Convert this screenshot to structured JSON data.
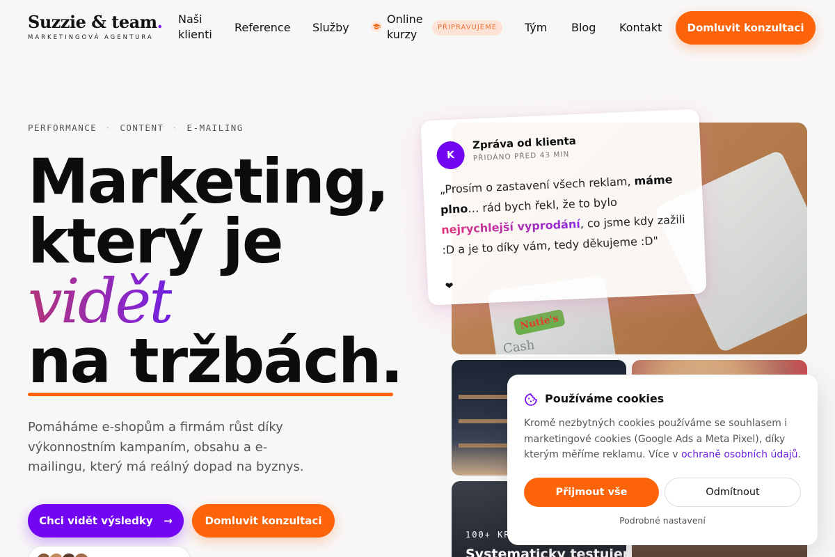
{
  "brand": {
    "name": "Suzzie & team",
    "dot": ".",
    "tagline": "MARKETINGOVÁ AGENTURA",
    "accent_color": "#7306f2",
    "cta_color": "#fd6409"
  },
  "nav": {
    "items": [
      {
        "label_line1": "Naši",
        "label_line2": "klienti"
      },
      {
        "label": "Reference"
      },
      {
        "label": "Služby"
      },
      {
        "label_line1": "Online",
        "label_line2": "kurzy",
        "icon": "graduation-cap-icon",
        "badge": "PŘIPRAVUJEME"
      },
      {
        "label": "Tým"
      },
      {
        "label": "Blog"
      },
      {
        "label": "Kontakt"
      }
    ],
    "cta": "Domluvit konzultaci"
  },
  "hero": {
    "eyebrow": [
      "PERFORMANCE",
      "CONTENT",
      "E-MAILING"
    ],
    "eyebrow_separator": "·",
    "title_line1": "Marketing,",
    "title_line2": "který je",
    "title_line3": "vidět",
    "title_line4": "na tržbách.",
    "description": "Pomáháme e-shopům a firmám růst díky výkonnostním kampaním, obsahu a e-mailingu, který má reálný dopad na byznys.",
    "primary_cta": "Chci vidět výsledky",
    "primary_cta_arrow": "→",
    "secondary_cta": "Domluvit konzultaci"
  },
  "client_message": {
    "avatar_letter": "K",
    "from": "Zpráva od klienta",
    "time": "PŘIDÁNO PŘED 43 MIN",
    "text_part1": "„Prosím o zastavení všech reklam, ",
    "text_bold": "máme plno",
    "text_part2": "… rád bych řekl, že to bylo ",
    "text_highlight": "nejrychlejší vyprodání",
    "text_part3": ", co jsme kdy zažili :D a je to díky vám, tedy děkujeme :D\"",
    "reaction": "❤"
  },
  "gallery": {
    "main_label": "Nutie's",
    "main_sub": "Cash",
    "tile_kicker": "100+ KR",
    "tile_title": "Systematicky testujeme, co opravdu"
  },
  "cookies": {
    "icon": "cookie-icon",
    "title": "Používáme cookies",
    "text": "Kromě nezbytných cookies používáme se souhlasem i marketingové cookies (Google Ads a Meta Pixel), díky kterým měříme reklamu. Více v ",
    "link": "ochraně osobních údajů",
    "text_end": ".",
    "accept": "Přijmout vše",
    "reject": "Odmítnout",
    "settings": "Podrobné nastavení"
  }
}
